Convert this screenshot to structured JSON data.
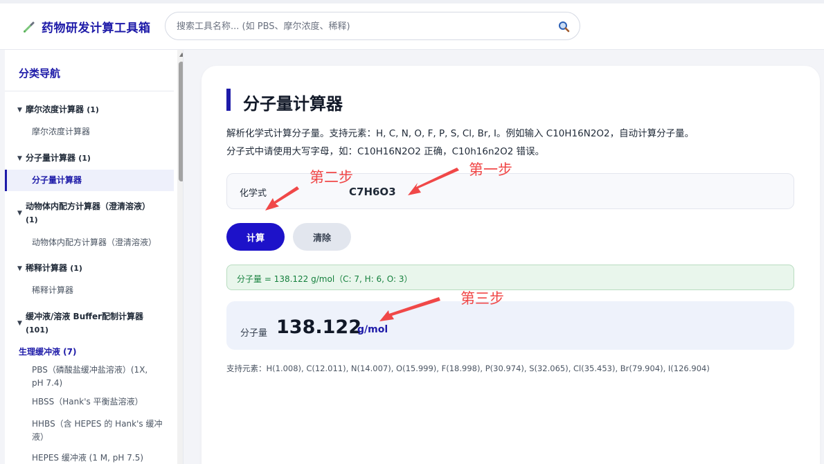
{
  "header": {
    "title": "药物研发计算工具箱",
    "search_placeholder": "搜索工具名称... (如 PBS、摩尔浓度、稀释)",
    "search_value": ""
  },
  "sidebar": {
    "heading": "分类导航",
    "categories": [
      {
        "label": "摩尔浓度计算器",
        "count": "(1)",
        "items": [
          "摩尔浓度计算器"
        ]
      },
      {
        "label": "分子量计算器",
        "count": "(1)",
        "items": [
          "分子量计算器"
        ]
      },
      {
        "label": "动物体内配方计算器（澄清溶液）",
        "count": "(1)",
        "items": [
          "动物体内配方计算器（澄清溶液）"
        ]
      },
      {
        "label": "稀释计算器",
        "count": "(1)",
        "items": [
          "稀释计算器"
        ]
      },
      {
        "label": "缓冲液/溶液 Buffer配制计算器",
        "count": "(101)",
        "subcategory": "生理缓冲液 (7)",
        "items": [
          "PBS（磷酸盐缓冲盐溶液）(1X, pH 7.4)",
          "HBSS（Hank's 平衡盐溶液）",
          "HHBS（含 HEPES 的 Hank's 缓冲液）",
          "HEPES 缓冲液 (1 M, pH 7.5)"
        ]
      }
    ],
    "active_item": "分子量计算器"
  },
  "main": {
    "title": "分子量计算器",
    "description_1": "解析化学式计算分子量。支持元素：H, C, N, O, F, P, S, Cl, Br, I。例如输入 C10H16N2O2，自动计算分子量。",
    "description_2": "分子式中请使用大写字母，如：C10H16N2O2 正确，C10h16n2O2 错误。",
    "formula_label": "化学式",
    "formula_value": "C7H6O3",
    "calc_button": "计算",
    "clear_button": "清除",
    "success_message": "分子量 = 138.122 g/mol（C: 7, H: 6, O: 3）",
    "result_label": "分子量",
    "result_value": "138.122",
    "result_unit": "g/mol",
    "footnote": "支持元素：H(1.008), C(12.011), N(14.007), O(15.999), F(18.998), P(30.974), S(32.065), Cl(35.453), Br(79.904), I(126.904)"
  },
  "annotations": {
    "step1": "第一步",
    "step2": "第二步",
    "step3": "第三步",
    "color": "#f04848"
  },
  "colors": {
    "accent": "#1d1aa8",
    "primary_button": "#1d12c9",
    "success_bg": "#e9f6ec",
    "success_text": "#15803d"
  }
}
